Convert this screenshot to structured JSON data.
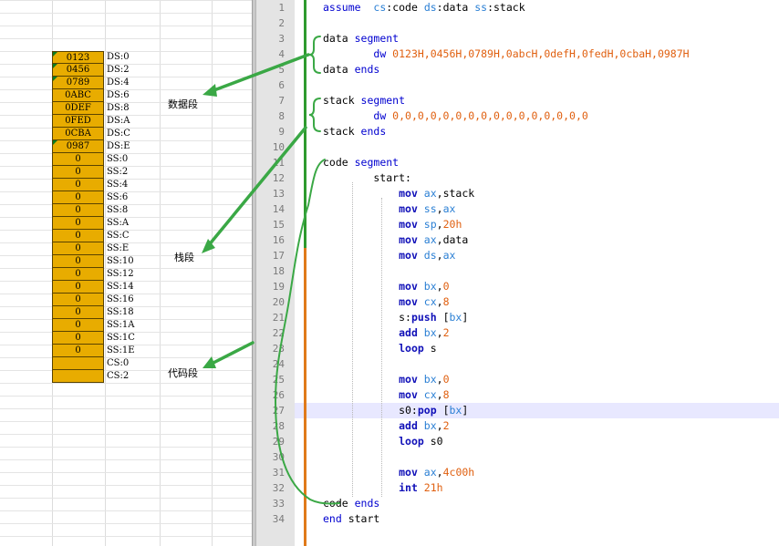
{
  "memory": [
    {
      "value": "0123",
      "label": "DS:0",
      "tick": true
    },
    {
      "value": "0456",
      "label": "DS:2",
      "tick": true
    },
    {
      "value": "0789",
      "label": "DS:4",
      "tick": true
    },
    {
      "value": "0ABC",
      "label": "DS:6",
      "tick": false
    },
    {
      "value": "0DEF",
      "label": "DS:8",
      "tick": false
    },
    {
      "value": "0FED",
      "label": "DS:A",
      "tick": false
    },
    {
      "value": "0CBA",
      "label": "DS:C",
      "tick": false
    },
    {
      "value": "0987",
      "label": "DS:E",
      "tick": true
    },
    {
      "value": "0",
      "label": "SS:0",
      "tick": false
    },
    {
      "value": "0",
      "label": "SS:2",
      "tick": false
    },
    {
      "value": "0",
      "label": "SS:4",
      "tick": false
    },
    {
      "value": "0",
      "label": "SS:6",
      "tick": false
    },
    {
      "value": "0",
      "label": "SS:8",
      "tick": false
    },
    {
      "value": "0",
      "label": "SS:A",
      "tick": false
    },
    {
      "value": "0",
      "label": "SS:C",
      "tick": false
    },
    {
      "value": "0",
      "label": "SS:E",
      "tick": false
    },
    {
      "value": "0",
      "label": "SS:10",
      "tick": false
    },
    {
      "value": "0",
      "label": "SS:12",
      "tick": false
    },
    {
      "value": "0",
      "label": "SS:14",
      "tick": false
    },
    {
      "value": "0",
      "label": "SS:16",
      "tick": false
    },
    {
      "value": "0",
      "label": "SS:18",
      "tick": false
    },
    {
      "value": "0",
      "label": "SS:1A",
      "tick": false
    },
    {
      "value": "0",
      "label": "SS:1C",
      "tick": false
    },
    {
      "value": "0",
      "label": "SS:1E",
      "tick": false
    },
    {
      "value": "",
      "label": "CS:0",
      "tick": false
    },
    {
      "value": "",
      "label": "CS:2",
      "tick": false
    }
  ],
  "segment_labels": {
    "data": "数据段",
    "stack": "栈段",
    "code": "代码段"
  },
  "editor": {
    "current_line": 27,
    "lines": [
      {
        "n": "1",
        "tokens": [
          [
            "kw",
            "assume"
          ],
          [
            "",
            "  "
          ],
          [
            "rg",
            "cs"
          ],
          [
            "",
            ":code "
          ],
          [
            "rg",
            "ds"
          ],
          [
            "",
            ":data "
          ],
          [
            "rg",
            "ss"
          ],
          [
            "",
            ":stack"
          ]
        ]
      },
      {
        "n": "2",
        "tokens": []
      },
      {
        "n": "3",
        "tokens": [
          [
            "",
            "data "
          ],
          [
            "kw",
            "segment"
          ]
        ]
      },
      {
        "n": "4",
        "tokens": [
          [
            "",
            "        "
          ],
          [
            "kw",
            "dw"
          ],
          [
            "nm",
            " 0123H,0456H,0789H,0abcH,0defH,0fedH,0cbaH,0987H"
          ]
        ]
      },
      {
        "n": "5",
        "tokens": [
          [
            "",
            "data "
          ],
          [
            "kw",
            "ends"
          ]
        ]
      },
      {
        "n": "6",
        "tokens": []
      },
      {
        "n": "7",
        "tokens": [
          [
            "",
            "stack "
          ],
          [
            "kw",
            "segment"
          ]
        ]
      },
      {
        "n": "8",
        "tokens": [
          [
            "",
            "        "
          ],
          [
            "kw",
            "dw"
          ],
          [
            "nm",
            " 0,0,0,0,0,0,0,0,0,0,0,0,0,0,0,0"
          ]
        ]
      },
      {
        "n": "9",
        "tokens": [
          [
            "",
            "stack "
          ],
          [
            "kw",
            "ends"
          ]
        ]
      },
      {
        "n": "10",
        "tokens": []
      },
      {
        "n": "11",
        "tokens": [
          [
            "",
            "code "
          ],
          [
            "kw",
            "segment"
          ]
        ]
      },
      {
        "n": "12",
        "tokens": [
          [
            "",
            "        start:"
          ]
        ]
      },
      {
        "n": "13",
        "tokens": [
          [
            "",
            "            "
          ],
          [
            "mn",
            "mov"
          ],
          [
            "",
            ""
          ],
          [
            "rg",
            " ax"
          ],
          [
            "",
            ",stack"
          ]
        ]
      },
      {
        "n": "14",
        "tokens": [
          [
            "",
            "            "
          ],
          [
            "mn",
            "mov"
          ],
          [
            "rg",
            " ss"
          ],
          [
            "",
            ","
          ],
          [
            "rg",
            "ax"
          ]
        ]
      },
      {
        "n": "15",
        "tokens": [
          [
            "",
            "            "
          ],
          [
            "mn",
            "mov"
          ],
          [
            "rg",
            " sp"
          ],
          [
            "",
            ","
          ],
          [
            "nm",
            "20h"
          ]
        ]
      },
      {
        "n": "16",
        "tokens": [
          [
            "",
            "            "
          ],
          [
            "mn",
            "mov"
          ],
          [
            "rg",
            " ax"
          ],
          [
            "",
            ",data"
          ]
        ]
      },
      {
        "n": "17",
        "tokens": [
          [
            "",
            "            "
          ],
          [
            "mn",
            "mov"
          ],
          [
            "rg",
            " ds"
          ],
          [
            "",
            ","
          ],
          [
            "rg",
            "ax"
          ]
        ]
      },
      {
        "n": "18",
        "tokens": []
      },
      {
        "n": "19",
        "tokens": [
          [
            "",
            "            "
          ],
          [
            "mn",
            "mov"
          ],
          [
            "rg",
            " bx"
          ],
          [
            "",
            ","
          ],
          [
            "nm",
            "0"
          ]
        ]
      },
      {
        "n": "20",
        "tokens": [
          [
            "",
            "            "
          ],
          [
            "mn",
            "mov"
          ],
          [
            "rg",
            " cx"
          ],
          [
            "",
            ","
          ],
          [
            "nm",
            "8"
          ]
        ]
      },
      {
        "n": "21",
        "tokens": [
          [
            "",
            "            s:"
          ],
          [
            "mn",
            "push"
          ],
          [
            "",
            " ["
          ],
          [
            "rg",
            "bx"
          ],
          [
            "",
            "]"
          ]
        ]
      },
      {
        "n": "22",
        "tokens": [
          [
            "",
            "            "
          ],
          [
            "mn",
            "add"
          ],
          [
            "rg",
            " bx"
          ],
          [
            "",
            ","
          ],
          [
            "nm",
            "2"
          ]
        ]
      },
      {
        "n": "23",
        "tokens": [
          [
            "",
            "            "
          ],
          [
            "mn",
            "loop"
          ],
          [
            "",
            " s"
          ]
        ]
      },
      {
        "n": "24",
        "tokens": []
      },
      {
        "n": "25",
        "tokens": [
          [
            "",
            "            "
          ],
          [
            "mn",
            "mov"
          ],
          [
            "rg",
            " bx"
          ],
          [
            "",
            ","
          ],
          [
            "nm",
            "0"
          ]
        ]
      },
      {
        "n": "26",
        "tokens": [
          [
            "",
            "            "
          ],
          [
            "mn",
            "mov"
          ],
          [
            "rg",
            " cx"
          ],
          [
            "",
            ","
          ],
          [
            "nm",
            "8"
          ]
        ]
      },
      {
        "n": "27",
        "tokens": [
          [
            "",
            "            s0:"
          ],
          [
            "mn",
            "pop"
          ],
          [
            "",
            " ["
          ],
          [
            "rg",
            "bx"
          ],
          [
            "",
            "]"
          ]
        ]
      },
      {
        "n": "28",
        "tokens": [
          [
            "",
            "            "
          ],
          [
            "mn",
            "add"
          ],
          [
            "rg",
            " bx"
          ],
          [
            "",
            ","
          ],
          [
            "nm",
            "2"
          ]
        ]
      },
      {
        "n": "29",
        "tokens": [
          [
            "",
            "            "
          ],
          [
            "mn",
            "loop"
          ],
          [
            "",
            " s0"
          ]
        ]
      },
      {
        "n": "30",
        "tokens": []
      },
      {
        "n": "31",
        "tokens": [
          [
            "",
            "            "
          ],
          [
            "mn",
            "mov"
          ],
          [
            "rg",
            " ax"
          ],
          [
            "",
            ","
          ],
          [
            "nm",
            "4c00h"
          ]
        ]
      },
      {
        "n": "32",
        "tokens": [
          [
            "",
            "            "
          ],
          [
            "mn",
            "int"
          ],
          [
            "nm",
            " 21h"
          ]
        ]
      },
      {
        "n": "33",
        "tokens": [
          [
            "",
            "code "
          ],
          [
            "kw",
            "ends"
          ]
        ]
      },
      {
        "n": "34",
        "tokens": [
          [
            "kw",
            "end"
          ],
          [
            "",
            " start"
          ]
        ]
      }
    ]
  },
  "colors": {
    "memory_fill": "#e8ac00",
    "annotation": "#3aa845",
    "changebar_saved": "#2e9a2e",
    "changebar_modified": "#e07a1a",
    "keyword": "#0000d0",
    "register": "#2a7fd4",
    "number": "#e06010"
  }
}
